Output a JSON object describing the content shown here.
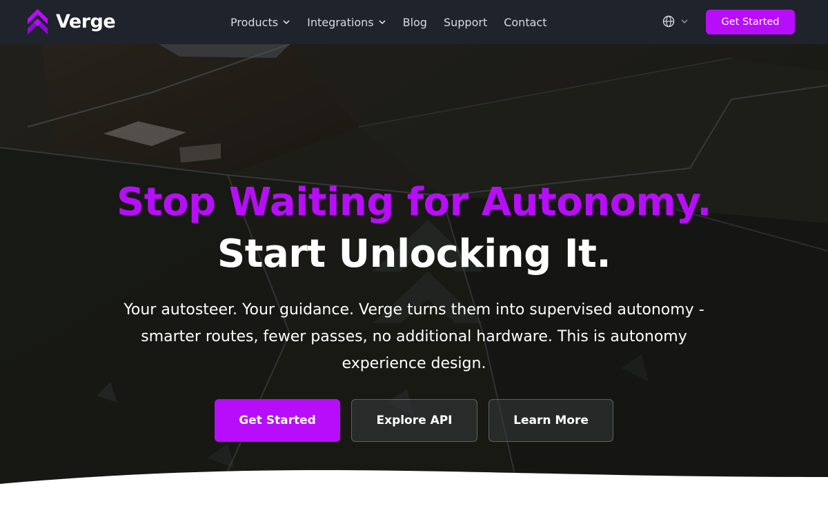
{
  "brand": {
    "name": "Verge",
    "logo_icon": "verge-chevron-logo",
    "accent": "#b80dfa"
  },
  "nav": {
    "items": [
      {
        "label": "Products",
        "dropdown": true
      },
      {
        "label": "Integrations",
        "dropdown": true
      },
      {
        "label": "Blog",
        "dropdown": false
      },
      {
        "label": "Support",
        "dropdown": false
      },
      {
        "label": "Contact",
        "dropdown": false
      }
    ],
    "language_icon": "globe-icon",
    "cta_label": "Get Started",
    "background": "#1f232b"
  },
  "hero": {
    "headline_line1": "Stop Waiting for Autonomy.",
    "headline_line2": "Start Unlocking It.",
    "subtext": "Your autosteer. Your guidance. Verge turns them into supervised autonomy - smarter routes, fewer passes, no additional hardware. This is autonomy experience design.",
    "buttons": {
      "primary": "Get Started",
      "secondary": "Explore API",
      "tertiary": "Learn More"
    },
    "background_image": "aerial view of farm fields at dusk"
  }
}
